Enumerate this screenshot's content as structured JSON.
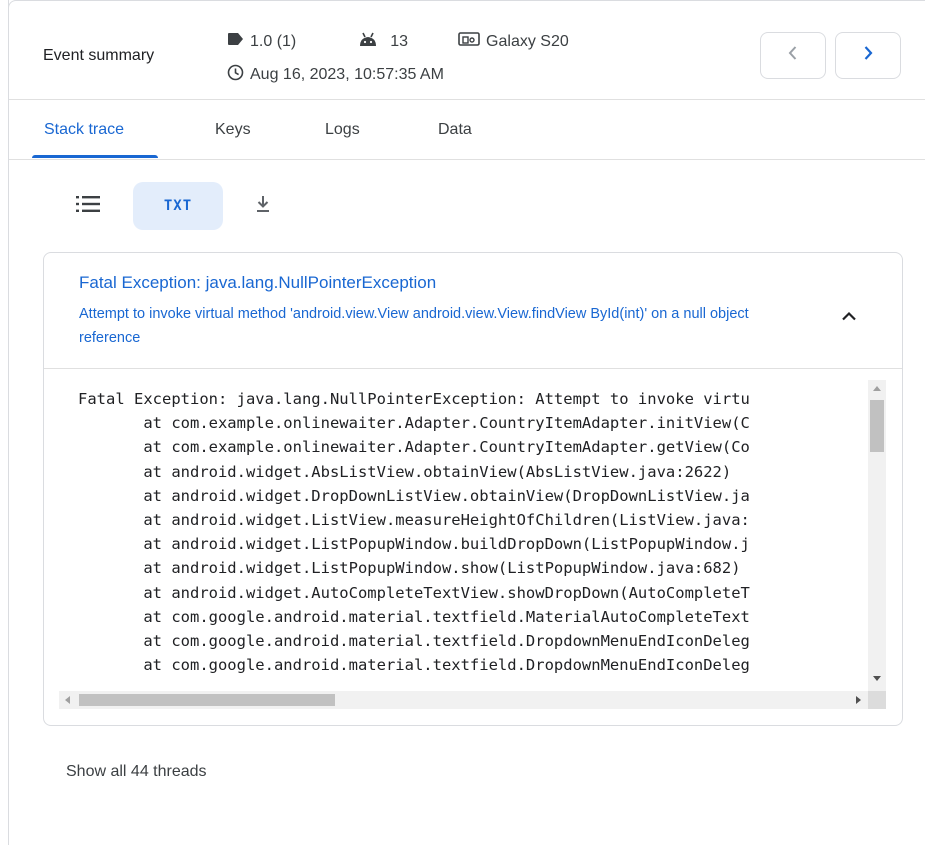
{
  "header": {
    "title": "Event summary",
    "version": "1.0 (1)",
    "android_version": "13",
    "device": "Galaxy S20",
    "timestamp": "Aug 16, 2023, 10:57:35 AM",
    "icons": {
      "version": "label-tag-icon",
      "android": "android-icon",
      "device": "device-icon",
      "time": "clock-icon",
      "prev": "chevron-left-icon",
      "next": "chevron-right-icon"
    }
  },
  "tabs": [
    {
      "label": "Stack trace",
      "active": true
    },
    {
      "label": "Keys",
      "active": false
    },
    {
      "label": "Logs",
      "active": false
    },
    {
      "label": "Data",
      "active": false
    }
  ],
  "view_toggle": {
    "txt_label": "TXT",
    "icons": {
      "list": "list-icon",
      "download": "download-icon"
    }
  },
  "exception": {
    "title": "Fatal Exception: java.lang.NullPointerException",
    "message": "Attempt to invoke virtual method 'android.view.View android.view.View.findView ById(int)' on a null object reference",
    "collapse_icon": "chevron-up-icon",
    "trace_lines": [
      "Fatal Exception: java.lang.NullPointerException: Attempt to invoke virtu",
      "       at com.example.onlinewaiter.Adapter.CountryItemAdapter.initView(C",
      "       at com.example.onlinewaiter.Adapter.CountryItemAdapter.getView(Co",
      "       at android.widget.AbsListView.obtainView(AbsListView.java:2622)",
      "       at android.widget.DropDownListView.obtainView(DropDownListView.ja",
      "       at android.widget.ListView.measureHeightOfChildren(ListView.java:",
      "       at android.widget.ListPopupWindow.buildDropDown(ListPopupWindow.j",
      "       at android.widget.ListPopupWindow.show(ListPopupWindow.java:682)",
      "       at android.widget.AutoCompleteTextView.showDropDown(AutoCompleteT",
      "       at com.google.android.material.textfield.MaterialAutoCompleteText",
      "       at com.google.android.material.textfield.DropdownMenuEndIconDeleg",
      "       at com.google.android.material.textfield.DropdownMenuEndIconDeleg"
    ]
  },
  "footer": {
    "show_threads": "Show all 44 threads"
  },
  "colors": {
    "accent": "#1967d2",
    "accent_soft": "#e3edfb",
    "border": "#dadce0",
    "text": "#202124",
    "text_secondary": "#3c4043"
  }
}
